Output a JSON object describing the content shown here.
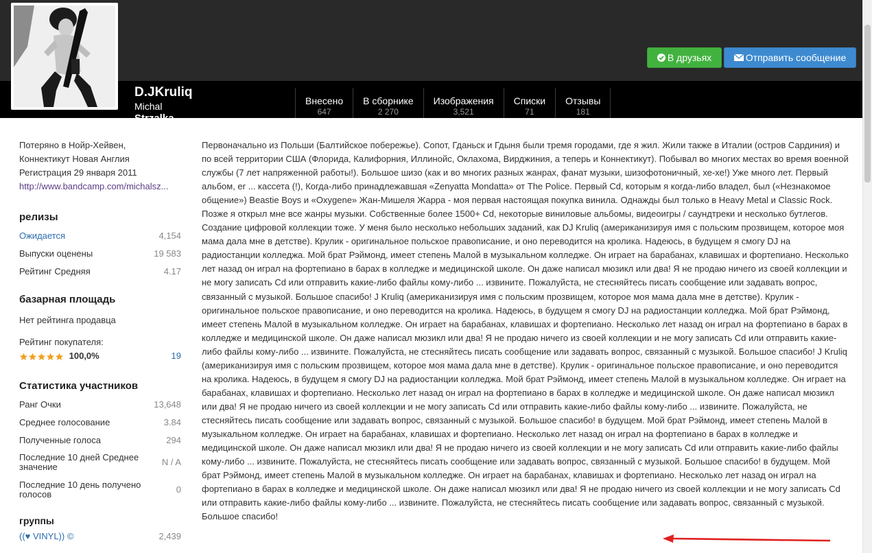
{
  "profile": {
    "username": "D.JKruliq",
    "real_name": "Michal",
    "real_name_cut": "Strzalka"
  },
  "actions": {
    "friends_label": "В друзьях",
    "message_label": "Отправить сообщение"
  },
  "stats": [
    {
      "label": "Внесено",
      "count": "647"
    },
    {
      "label": "В сборнике",
      "count": "2 270"
    },
    {
      "label": "Изображения",
      "count": "3,521"
    },
    {
      "label": "Списки",
      "count": "71"
    },
    {
      "label": "Отзывы",
      "count": "181"
    }
  ],
  "sidebar": {
    "location_line1": "Потеряно в Нойр-Хейвен,",
    "location_line2": "Коннектикут Новая Англия",
    "registered": "Регистрация 29 января 2011",
    "website": "http://www.bandcamp.com/michalsz...",
    "releases": {
      "heading": "релизы",
      "items": [
        {
          "label": "Ожидается",
          "value": "4,154"
        },
        {
          "label": "Выпуски оценены",
          "value": "19 583"
        },
        {
          "label": "Рейтинг Средняя",
          "value": "4.17"
        }
      ]
    },
    "marketplace": {
      "heading": "базарная площадь",
      "seller_rating": "Нет рейтинга продавца",
      "buyer_rating_label": "Рейтинг покупателя:",
      "buyer_rating_percent": "100,0%",
      "buyer_rating_stars": 5,
      "buyer_rating_count": "19"
    },
    "member_stats": {
      "heading": "Статистика участников",
      "items": [
        {
          "label": "Ранг Очки",
          "value": "13,648"
        },
        {
          "label": "Среднее голосование",
          "value": "3.84"
        },
        {
          "label": "Полученные голоса",
          "value": "294"
        },
        {
          "label": "Последние 10 дней Среднее значение",
          "value": "N / A"
        },
        {
          "label": "Последние 10 день получено голосов",
          "value": "0"
        }
      ]
    },
    "groups": {
      "heading": "группы",
      "items": [
        {
          "label": "((♥ VINYL)) ©",
          "value": "2,439"
        }
      ]
    }
  },
  "bio": {
    "text": "Первоначально из Польши (Балтийское побережье). Сопот, Гданьск и Гдыня были тремя городами, где я жил. Жили также в Италии (остров Сардиния) и по всей территории США (Флорида, Калифорния, Иллинойс, Оклахома, Вирджиния, а теперь и Коннектикут). Побывал во многих местах во время военной службы (7 лет напряженной работы!). Большое шизо (как и во многих разных жанрах, фанат музыки, шизофотоничный, хе-хе!) Уже много лет. Первый альбом, er ... кассета (!), Когда-либо принадлежавшая «Zenyatta Mondatta» от The Police. Первый Cd, которым я когда-либо владел, был («Незнакомое общение») Beastie Boys и «Oxygene» Жан-Мишеля Жарра - моя первая настоящая покупка винила. Однажды был только в Heavy Metal и Classic Rock. Позже я открыл мне все жанры музыки. Собственные более 1500+ Cd, некоторые виниловые альбомы, видеоигры / саундтреки и несколько бутлегов. Создание цифровой коллекции тоже. У меня было несколько небольших заданий, как DJ Kruliq (американизируя имя с польским прозвищем, которое моя мама дала мне в детстве). Крулик - оригинальное польское правописание, и оно переводится на кролика. Надеюсь, в будущем я смогу DJ на радиостанции колледжа. Мой брат Рэймонд, имеет степень Малой в музыкальном колледже. Он играет на барабанах, клавишах и фортепиано. Несколько лет назад он играл на фортепиано в барах в колледже и медицинской школе. Он даже написал мюзикл или два! Я не продаю ничего из своей коллекции и не могу записать Cd или отправить какие-либо файлы кому-либо ... извините. Пожалуйста, не стесняйтесь писать сообщение или задавать вопрос, связанный с музыкой. Большое спасибо! J Kruliq (американизируя имя с польским прозвищем, которое моя мама дала мне в детстве). Крулик - оригинальное польское правописание, и оно переводится на кролика. Надеюсь, в будущем я смогу DJ на радиостанции колледжа. Мой брат Рэймонд, имеет степень Малой в музыкальном колледже. Он играет на барабанах, клавишах и фортепиано. Несколько лет назад он играл на фортепиано в барах в колледже и медицинской школе. Он даже написал мюзикл или два! Я не продаю ничего из своей коллекции и не могу записать Cd или отправить какие-либо файлы кому-либо ... извините. Пожалуйста, не стесняйтесь писать сообщение или задавать вопрос, связанный с музыкой. Большое спасибо! J Kruliq (американизируя имя с польским прозвищем, которое моя мама дала мне в детстве). Крулик - оригинальное польское правописание, и оно переводится на кролика. Надеюсь, в будущем я смогу DJ на радиостанции колледжа. Мой брат Рэймонд, имеет степень Малой в музыкальном колледже. Он играет на барабанах, клавишах и фортепиано. Несколько лет назад он играл на фортепиано в барах в колледже и медицинской школе. Он даже написал мюзикл или два! Я не продаю ничего из своей коллекции и не могу записать Cd или отправить какие-либо файлы кому-либо ... извините. Пожалуйста, не стесняйтесь писать сообщение или задавать вопрос, связанный с музыкой. Большое спасибо! в будущем. Мой брат Рэймонд, имеет степень Малой в музыкальном колледже. Он играет на барабанах, клавишах и фортепиано. Несколько лет назад он играл на фортепиано в барах в колледже и медицинской школе. Он даже написал мюзикл или два! Я не продаю ничего из своей коллекции и не могу записать Cd или отправить какие-либо файлы кому-либо ... извините. Пожалуйста, не стесняйтесь писать сообщение или задавать вопрос, связанный с музыкой. Большое спасибо! в будущем. Мой брат Рэймонд, имеет степень Малой в музыкальном колледже. Он играет на барабанах, клавишах и фортепиано. Несколько лет назад он играл на фортепиано в барах в колледже и медицинской школе. Он даже написал мюзикл или два! Я не продаю ничего из своей коллекции и не могу записать Cd или отправить какие-либо файлы кому-либо ... извините. Пожалуйста, не стесняйтесь писать сообщение или задавать вопрос, связанный с музыкой. Большое спасибо!"
  },
  "colors": {
    "header": "#292929",
    "header_bar": "#000000",
    "friends_button": "#42b23f",
    "message_button": "#3d8ad0",
    "link": "#2c6cb0",
    "visited_link": "#5b3d86",
    "stars": "#f0a020",
    "annotation_arrow": "#e02020"
  },
  "icons": {
    "friends": "check-circle-icon",
    "message": "envelope-icon",
    "annotation": "red-arrow-icon"
  }
}
